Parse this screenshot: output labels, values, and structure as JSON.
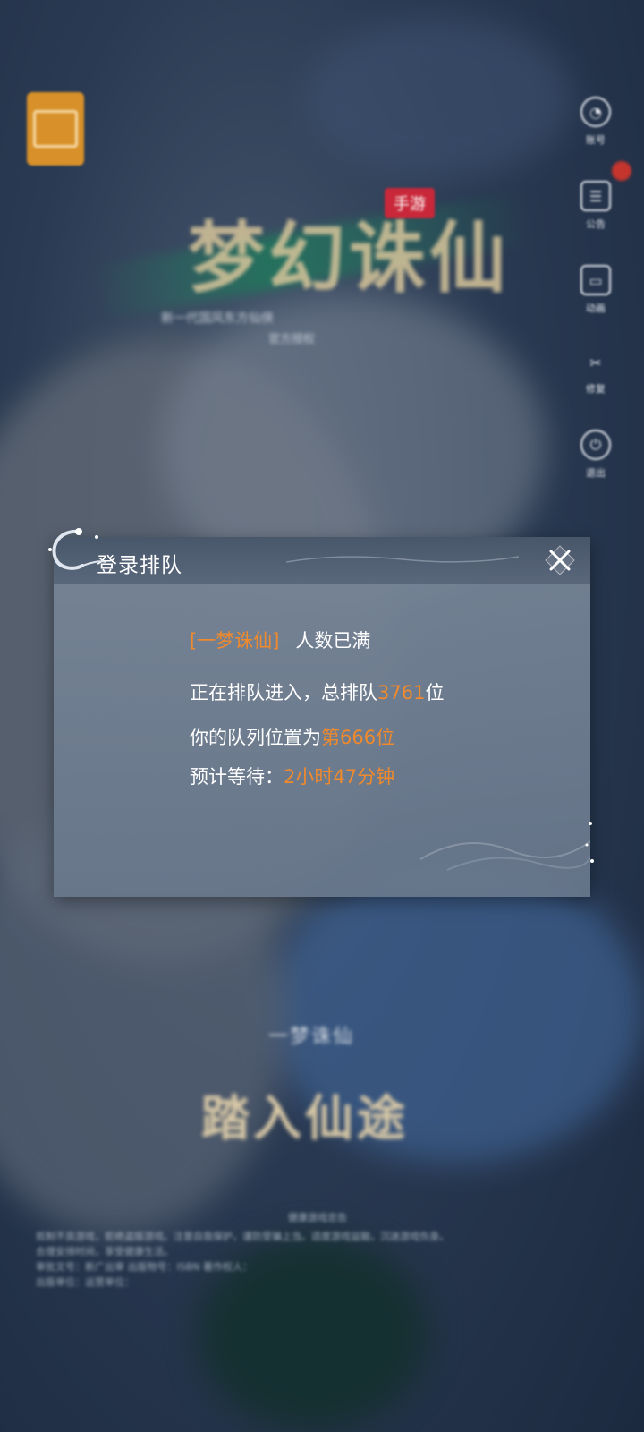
{
  "background": {
    "logo_label": "",
    "game_title": "梦幻诛仙",
    "mobile_tag": "手游",
    "subtitle": "新一代国风东方仙侠",
    "subtitle2": "官方授权",
    "bottom_small": "一梦诛仙",
    "bottom_big": "踏入仙途",
    "legal_head": "健康游戏忠告",
    "legal_lines": [
      "抵制不良游戏，拒绝盗版游戏。注意自我保护，谨防受骗上当。适度游戏益脑，沉迷游戏伤身。",
      "合理安排时间，享受健康生活。",
      "审批文号：新广出审 出版物号：ISBN 著作权人：",
      "出版单位：运营单位："
    ]
  },
  "side_menu": [
    {
      "icon": "account-icon",
      "glyph": "◔",
      "label": "账号"
    },
    {
      "icon": "notice-icon",
      "glyph": "☰",
      "label": "公告"
    },
    {
      "icon": "video-icon",
      "glyph": "▭",
      "label": "动画"
    },
    {
      "icon": "repair-icon",
      "glyph": "✂",
      "label": "修复"
    },
    {
      "icon": "exit-icon",
      "glyph": "⏻",
      "label": "退出"
    }
  ],
  "dialog": {
    "title": "登录排队",
    "server_name": "[一梦诛仙]",
    "server_status": "人数已满",
    "queue_prefix": "正在排队进入，总排队",
    "queue_total": "3761",
    "queue_suffix": "位",
    "position_prefix": "你的队列位置为",
    "position_value": "第666位",
    "wait_prefix": "预计等待：",
    "wait_value": "2小时47分钟"
  },
  "colors": {
    "accent_orange": "#f08a2c",
    "dialog_bg": "#76869a",
    "text_white": "#ffffff"
  }
}
